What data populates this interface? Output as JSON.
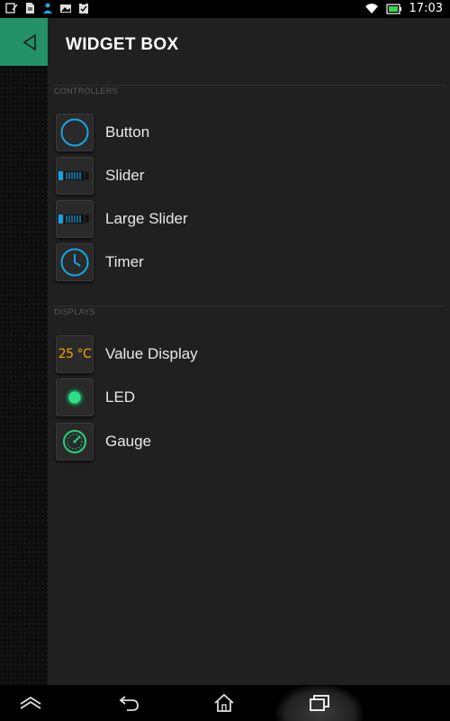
{
  "status_bar": {
    "time": "17:03",
    "left_icons": [
      "notes-icon",
      "file-icon",
      "person-icon",
      "image-icon",
      "clipboard-icon"
    ],
    "right_icons": [
      "wifi-icon",
      "battery-icon"
    ]
  },
  "background_app": {
    "toolbar_color": "#23916a",
    "back_icon": "triangle-back-icon"
  },
  "drawer": {
    "title": "WIDGET BOX",
    "sections": [
      {
        "label": "CONTROLLERS",
        "items": [
          {
            "label": "Button",
            "icon": "button-circle-icon"
          },
          {
            "label": "Slider",
            "icon": "slider-icon"
          },
          {
            "label": "Large Slider",
            "icon": "large-slider-icon"
          },
          {
            "label": "Timer",
            "icon": "timer-clock-icon"
          }
        ]
      },
      {
        "label": "DISPLAYS",
        "items": [
          {
            "label": "Value Display",
            "icon": "value-display-icon",
            "icon_text": "25 °C"
          },
          {
            "label": "LED",
            "icon": "led-icon"
          },
          {
            "label": "Gauge",
            "icon": "gauge-icon"
          }
        ]
      }
    ]
  },
  "nav_bar": {
    "buttons": [
      "hide-keyboard-icon",
      "back-icon",
      "home-icon",
      "recents-icon"
    ]
  },
  "colors": {
    "accent_blue": "#1aa3e0",
    "accent_green": "#23d07f",
    "accent_orange": "#f0a600",
    "drawer_bg": "#202020"
  }
}
